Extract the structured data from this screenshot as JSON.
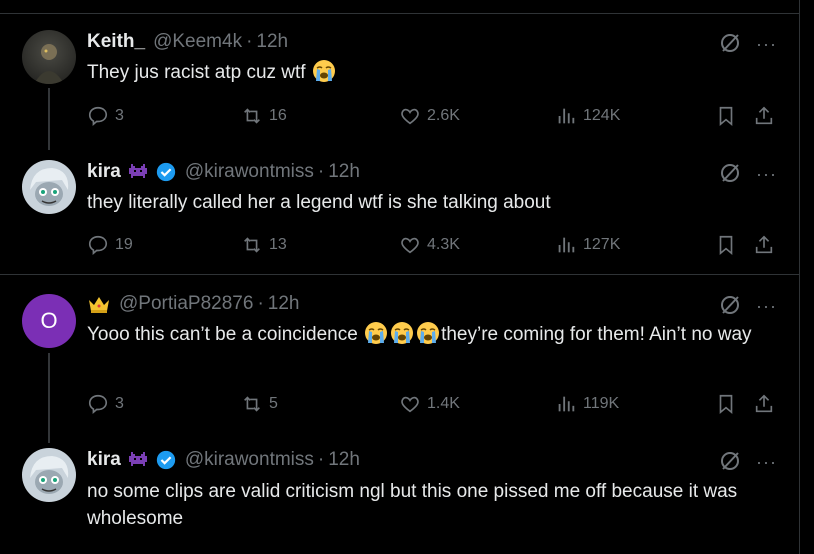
{
  "tweets": [
    {
      "name": "Keith_",
      "handle": "@Keem4k",
      "time": "12h",
      "text": "They jus racist atp cuz wtf ",
      "emoji": "loudly-crying-face",
      "replies": "3",
      "reposts": "16",
      "likes": "2.6K",
      "views": "124K"
    },
    {
      "name": "kira",
      "handle": "@kirawontmiss",
      "time": "12h",
      "text": "they literally called her a legend wtf is she talking about",
      "replies": "19",
      "reposts": "13",
      "likes": "4.3K",
      "views": "127K"
    },
    {
      "name": "",
      "avatar_letter": "O",
      "handle": "@PortiaP82876",
      "time": "12h",
      "text_before": "Yooo this can’t be a coincidence ",
      "text_after": "they’re coming for them! Ain’t no way",
      "emoji": "loudly-crying-face",
      "replies": "3",
      "reposts": "5",
      "likes": "1.4K",
      "views": "119K"
    },
    {
      "name": "kira",
      "handle": "@kirawontmiss",
      "time": "12h",
      "text": "no some clips are valid criticism ngl but this one pissed me off because it was wholesome"
    }
  ],
  "colors": {
    "background": "#000000",
    "text": "#e7e9ea",
    "muted": "#71767b",
    "verified": "#1d9bf0",
    "avatar_purple": "#7b2fb5",
    "border": "#2f3336"
  },
  "ui": {
    "separator_dot": "·",
    "more": "···"
  }
}
